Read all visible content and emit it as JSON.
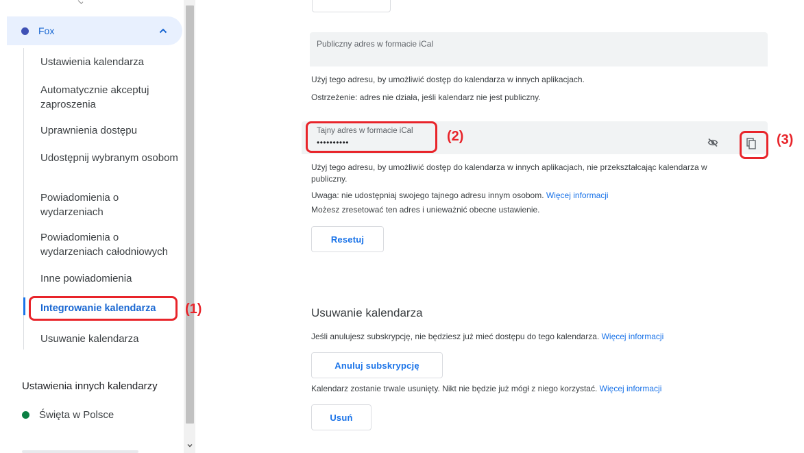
{
  "sidebar": {
    "calendar": {
      "name": "Fox",
      "color": "#3f51b5"
    },
    "items": [
      {
        "label": "Ustawienia kalendarza",
        "active": false
      },
      {
        "label": "Automatycznie akceptuj zaproszenia",
        "active": false
      },
      {
        "label": "Uprawnienia dostępu",
        "active": false
      },
      {
        "label": "Udostępnij wybranym osobom",
        "active": false
      },
      {
        "label": "Powiadomienia o wydarzeniach",
        "active": false
      },
      {
        "label": "Powiadomienia o wydarzeniach całodniowych",
        "active": false
      },
      {
        "label": "Inne powiadomienia",
        "active": false
      },
      {
        "label": "Integrowanie kalendarza",
        "active": true
      },
      {
        "label": "Usuwanie kalendarza",
        "active": false
      }
    ],
    "other_section": "Ustawienia innych kalendarzy",
    "other_calendars": [
      {
        "name": "Święta w Polsce",
        "color": "#0b8043"
      }
    ]
  },
  "integration": {
    "public_ical": {
      "label": "Publiczny adres w formacie iCal"
    },
    "public_help_1": "Użyj tego adresu, by umożliwić dostęp do kalendarza w innych aplikacjach.",
    "public_help_2": "Ostrzeżenie: adres nie działa, jeśli kalendarz nie jest publiczny.",
    "secret_ical": {
      "label": "Tajny adres w formacie iCal",
      "value": "••••••••••"
    },
    "secret_help_1": "Użyj tego adresu, by umożliwić dostęp do kalendarza w innych aplikacjach, nie przekształcając kalendarza w publiczny.",
    "secret_warning": "Uwaga: nie udostępniaj swojego tajnego adresu innym osobom.",
    "secret_more_info": "Więcej informacji",
    "reset_help": "Możesz zresetować ten adres i unieważnić obecne ustawienie.",
    "reset_button": "Resetuj"
  },
  "removal": {
    "title": "Usuwanie kalendarza",
    "unsubscribe_help": "Jeśli anulujesz subskrypcję, nie będziesz już mieć dostępu do tego kalendarza.",
    "unsubscribe_more_info": "Więcej informacji",
    "unsubscribe_button": "Anuluj subskrypcję",
    "delete_help": "Kalendarz zostanie trwale usunięty. Nikt nie będzie już mógł z niego korzystać.",
    "delete_more_info": "Więcej informacji",
    "delete_button": "Usuń"
  },
  "annotations": {
    "label_1": "(1)",
    "label_2": "(2)",
    "label_3": "(3)",
    "color": "#e8242a"
  }
}
